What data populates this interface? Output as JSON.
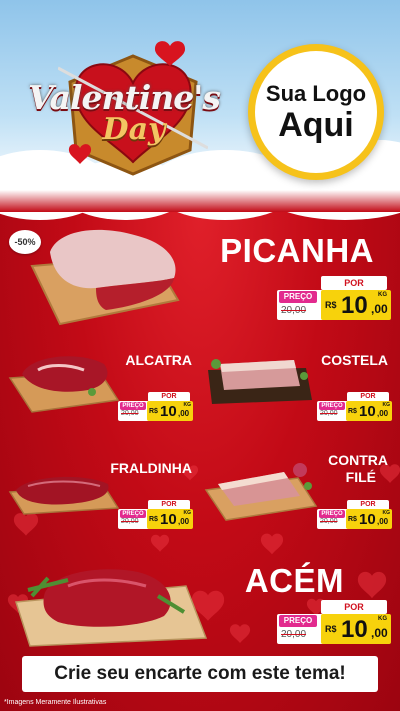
{
  "header": {
    "title": "Valentine's",
    "subtitle": "Day",
    "logo_line1": "Sua Logo",
    "logo_line2": "Aqui"
  },
  "colors": {
    "background_red": "#c20a16",
    "price_yellow": "#f7d20c",
    "preco_pink": "#e22a8e",
    "logo_ring": "#f6c21a"
  },
  "discount_badge": "-50%",
  "price_labels": {
    "por": "POR",
    "preco": "PREÇO",
    "currency": "R$",
    "unit": "KG"
  },
  "products": [
    {
      "name": "PICANHA",
      "old_price": "20,00",
      "price_int": "10",
      "price_dec": ",00"
    },
    {
      "name": "ALCATRA",
      "old_price": "20,00",
      "price_int": "10",
      "price_dec": ",00"
    },
    {
      "name": "COSTELA",
      "old_price": "20,00",
      "price_int": "10",
      "price_dec": ",00"
    },
    {
      "name": "FRALDINHA",
      "old_price": "20,00",
      "price_int": "10",
      "price_dec": ",00"
    },
    {
      "name_line1": "CONTRA",
      "name_line2": "FILÉ",
      "old_price": "20,00",
      "price_int": "10",
      "price_dec": ",00"
    },
    {
      "name": "ACÉM",
      "old_price": "20,00",
      "price_int": "10",
      "price_dec": ",00"
    }
  ],
  "banner_text": "Crie seu encarte com este tema!",
  "footnote": "*Imagens Meramente Ilustrativas"
}
